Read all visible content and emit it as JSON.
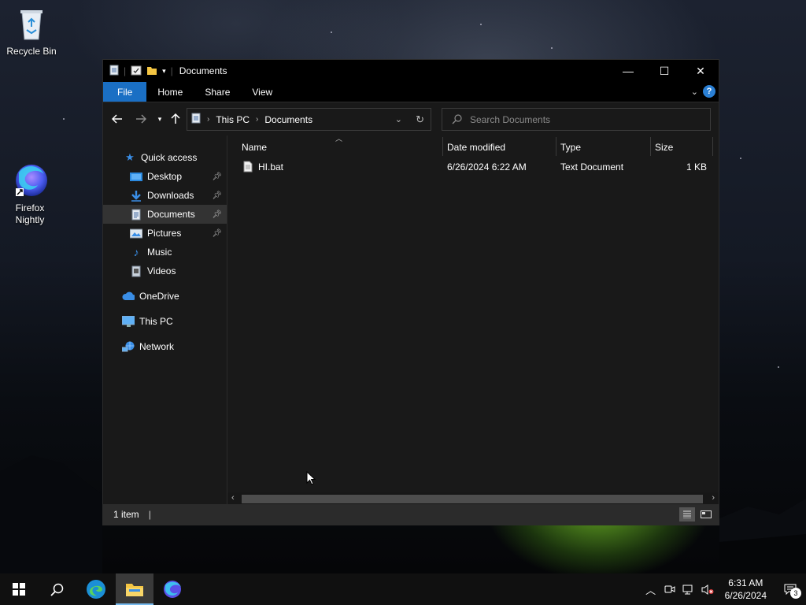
{
  "desktop": {
    "icons": [
      {
        "label": "Recycle Bin",
        "icon": "recycle-bin-icon"
      },
      {
        "label": "Firefox Nightly",
        "icon": "firefox-nightly-icon"
      }
    ]
  },
  "window": {
    "title": "Documents",
    "controls": {
      "minimize": "—",
      "maximize": "☐",
      "close": "✕"
    },
    "ribbon_tabs": [
      "File",
      "Home",
      "Share",
      "View"
    ],
    "help_label": "?",
    "address": {
      "crumbs": [
        "This PC",
        "Documents"
      ]
    },
    "search": {
      "placeholder": "Search Documents"
    },
    "sidebar": {
      "quick_access": "Quick access",
      "items": [
        {
          "label": "Desktop",
          "pinned": true
        },
        {
          "label": "Downloads",
          "pinned": true
        },
        {
          "label": "Documents",
          "pinned": true,
          "selected": true
        },
        {
          "label": "Pictures",
          "pinned": true
        },
        {
          "label": "Music",
          "pinned": false
        },
        {
          "label": "Videos",
          "pinned": false
        }
      ],
      "onedrive": "OneDrive",
      "this_pc": "This PC",
      "network": "Network"
    },
    "columns": [
      "Name",
      "Date modified",
      "Type",
      "Size"
    ],
    "files": [
      {
        "name": "HI.bat",
        "date_modified": "6/26/2024 6:22 AM",
        "type": "Text Document",
        "size": "1 KB"
      }
    ],
    "status": {
      "count": "1 item"
    }
  },
  "taskbar": {
    "clock_time": "6:31 AM",
    "clock_date": "6/26/2024",
    "notifications_count": "3"
  },
  "colors": {
    "accent": "#1a6fc4",
    "window_bg": "#191919",
    "titlebar_bg": "#000000"
  }
}
